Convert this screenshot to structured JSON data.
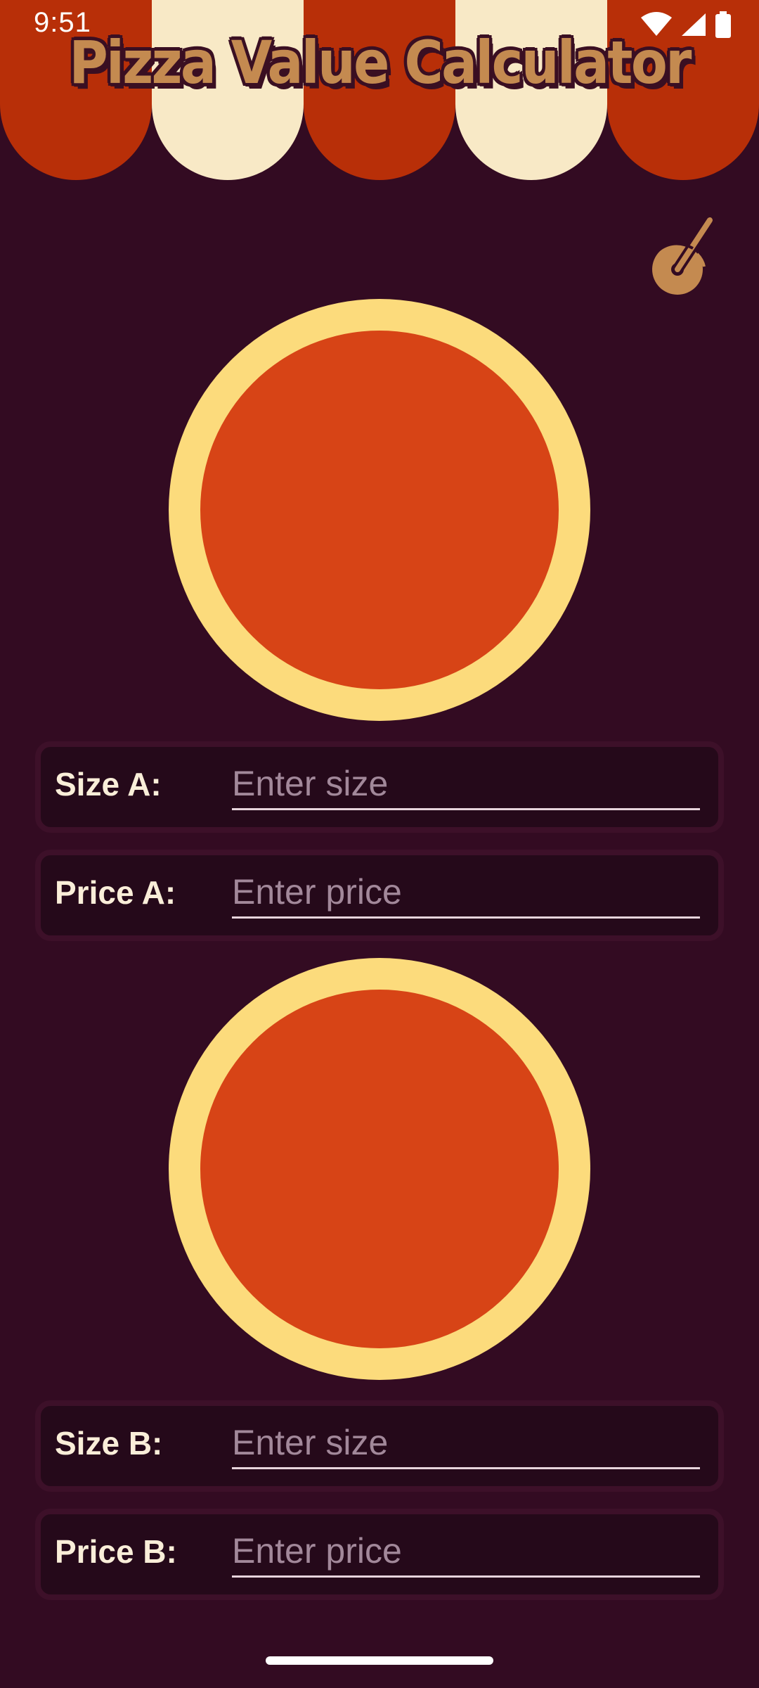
{
  "status_bar": {
    "time": "9:51",
    "icons": [
      "wifi-icon",
      "signal-icon",
      "battery-icon"
    ]
  },
  "header": {
    "title": "Pizza Value Calculator"
  },
  "settings_button": {
    "icon": "pizza-cutter-icon"
  },
  "pizza_a": {
    "size_label": "Size A:",
    "size_placeholder": "Enter size",
    "size_value": "",
    "price_label": "Price A:",
    "price_placeholder": "Enter price",
    "price_value": ""
  },
  "pizza_b": {
    "size_label": "Size B:",
    "size_placeholder": "Enter size",
    "size_value": "",
    "price_label": "Price B:",
    "price_placeholder": "Enter price",
    "price_value": ""
  },
  "colors": {
    "background": "#330b22",
    "awning_red": "#b82f08",
    "awning_cream": "#f8e9c6",
    "crust": "#fcdb7c",
    "sauce": "#d74416",
    "title": "#c48a50",
    "card": "#25091a"
  }
}
